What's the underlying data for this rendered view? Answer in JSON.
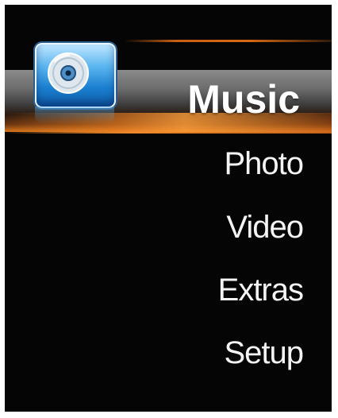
{
  "menu": {
    "selected_label": "Music",
    "items": [
      {
        "label": "Photo"
      },
      {
        "label": "Video"
      },
      {
        "label": "Extras"
      },
      {
        "label": "Setup"
      }
    ]
  },
  "icons": {
    "selected_icon": "disc-icon"
  },
  "colors": {
    "background": "#050505",
    "accent": "#d96a14",
    "text": "#f4f4f4",
    "icon_blue": "#1a7fd0"
  }
}
